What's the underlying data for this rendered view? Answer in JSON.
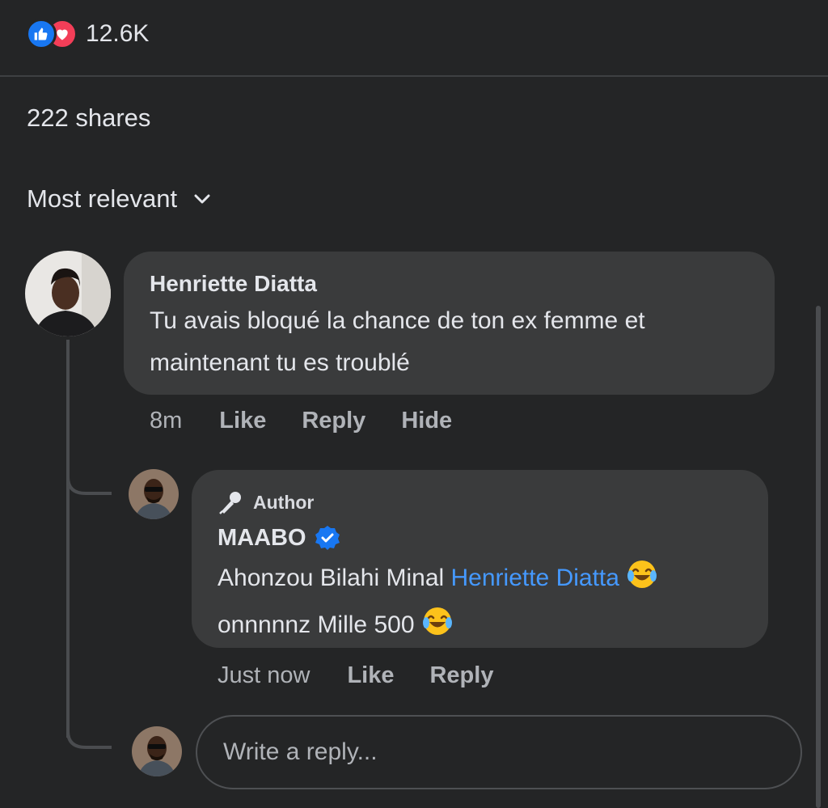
{
  "reactions": {
    "count": "12.6K",
    "types": [
      "like-icon",
      "love-icon"
    ],
    "like_color": "#1877f2",
    "love_color": "#f33e58"
  },
  "shares": "222 shares",
  "sort": {
    "label": "Most relevant"
  },
  "comment": {
    "author": "Henriette Diatta",
    "text_line1": "Tu avais  bloqué  la chance de ton ex femme et",
    "text_line2": "maintenant  tu es troublé",
    "time": "8m",
    "like": "Like",
    "reply": "Reply",
    "hide": "Hide"
  },
  "reply": {
    "badge": "Author",
    "author": "MAABO",
    "verified": true,
    "text_prefix": "Ahonzou Bilahi Minal ",
    "mention": "Henriette Diatta",
    "text_line2": "onnnnnz Mille 500",
    "time": "Just now",
    "like": "Like",
    "reply": "Reply"
  },
  "composer": {
    "placeholder": "Write a reply..."
  },
  "colors": {
    "background": "#242526",
    "bubble": "#3a3b3c",
    "mention": "#4599ff",
    "verified": "#1877f2"
  }
}
